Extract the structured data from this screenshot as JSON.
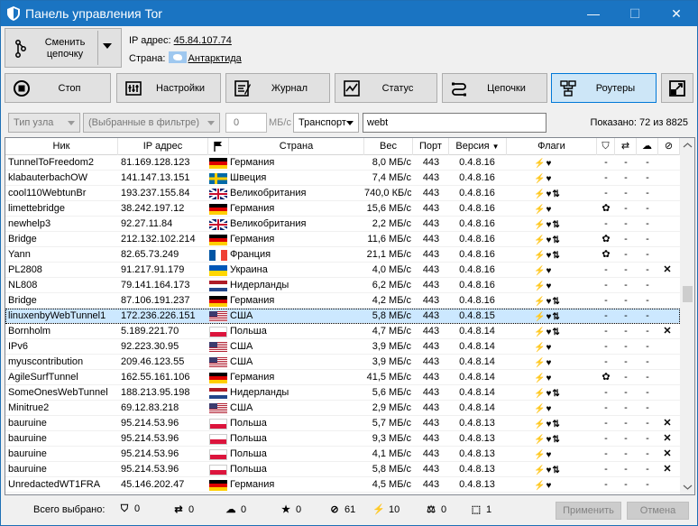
{
  "window": {
    "title": "Панель управления Tor",
    "min": "—",
    "max": "☐",
    "close": "✕"
  },
  "top": {
    "chain_button": "Сменить цепочку",
    "ip_label": "IP адрес:",
    "ip_value": "45.84.107.74",
    "country_label": "Страна:",
    "country_value": "Антарктида"
  },
  "nav": [
    {
      "label": "Стоп",
      "icon": "stop-icon"
    },
    {
      "label": "Настройки",
      "icon": "settings-icon"
    },
    {
      "label": "Журнал",
      "icon": "journal-icon"
    },
    {
      "label": "Статус",
      "icon": "status-icon"
    },
    {
      "label": "Цепочки",
      "icon": "chains-icon"
    },
    {
      "label": "Роутеры",
      "icon": "routers-icon",
      "active": true
    }
  ],
  "filters": {
    "node_type": "Тип узла",
    "selection": "(Выбранные в фильтре)",
    "speed_value": "0",
    "speed_unit": "МБ/с",
    "transport": "Транспорт",
    "search_value": "webt",
    "shown": "Показано: 72 из 8825"
  },
  "columns": {
    "nick": "Ник",
    "ip": "IP адрес",
    "country": "Страна",
    "weight": "Вес",
    "port": "Порт",
    "version": "Версия",
    "flags": "Флаги"
  },
  "flag_colors": {
    "de": [
      "#000000",
      "#dd0000",
      "#ffce00"
    ],
    "se": "#006aa7",
    "gb": "#012169",
    "fr": [
      "#0055a4",
      "#ffffff",
      "#ef4135"
    ],
    "ua": [
      "#0057b7",
      "#ffd700"
    ],
    "nl": [
      "#ae1c28",
      "#ffffff",
      "#21468b"
    ],
    "us": "#b22234",
    "pl": [
      "#ffffff",
      "#dc143c"
    ]
  },
  "rows": [
    {
      "nick": "TunnelToFreedom2",
      "ip": "81.169.128.123",
      "cc": "de",
      "country": "Германия",
      "speed": "8,0 МБ/с",
      "port": "443",
      "version": "0.4.8.16",
      "flags": "fh",
      "g1": "-",
      "g2": "-",
      "g3": "-",
      "g4": ""
    },
    {
      "nick": "klabauterbachOW",
      "ip": "141.147.13.151",
      "cc": "se",
      "country": "Швеция",
      "speed": "7,4 МБ/с",
      "port": "443",
      "version": "0.4.8.16",
      "flags": "fh",
      "g1": "-",
      "g2": "-",
      "g3": "-",
      "g4": ""
    },
    {
      "nick": "cool110WebtunBr",
      "ip": "193.237.155.84",
      "cc": "gb",
      "country": "Великобритания",
      "speed": "740,0 КБ/с",
      "port": "443",
      "version": "0.4.8.16",
      "flags": "fhs",
      "g1": "-",
      "g2": "-",
      "g3": "-",
      "g4": ""
    },
    {
      "nick": "limettebridge",
      "ip": "38.242.197.12",
      "cc": "de",
      "country": "Германия",
      "speed": "15,6 МБ/с",
      "port": "443",
      "version": "0.4.8.16",
      "flags": "fh",
      "g1": "✿",
      "g2": "-",
      "g3": "-",
      "g4": ""
    },
    {
      "nick": "newhelp3",
      "ip": "92.27.11.84",
      "cc": "gb",
      "country": "Великобритания",
      "speed": "2,2 МБ/с",
      "port": "443",
      "version": "0.4.8.16",
      "flags": "fhs",
      "g1": "-",
      "g2": "-",
      "g3": "-",
      "g4": ""
    },
    {
      "nick": "Bridge",
      "ip": "212.132.102.214",
      "cc": "de",
      "country": "Германия",
      "speed": "11,6 МБ/с",
      "port": "443",
      "version": "0.4.8.16",
      "flags": "fhs",
      "g1": "✿",
      "g2": "-",
      "g3": "-",
      "g4": ""
    },
    {
      "nick": "Yann",
      "ip": "82.65.73.249",
      "cc": "fr",
      "country": "Франция",
      "speed": "21,1 МБ/с",
      "port": "443",
      "version": "0.4.8.16",
      "flags": "fhs",
      "g1": "✿",
      "g2": "-",
      "g3": "-",
      "g4": ""
    },
    {
      "nick": "PL2808",
      "ip": "91.217.91.179",
      "cc": "ua",
      "country": "Украина",
      "speed": "4,0 МБ/с",
      "port": "443",
      "version": "0.4.8.16",
      "flags": "fh",
      "g1": "-",
      "g2": "-",
      "g3": "-",
      "g4": "✕"
    },
    {
      "nick": "NL808",
      "ip": "79.141.164.173",
      "cc": "nl",
      "country": "Нидерланды",
      "speed": "6,2 МБ/с",
      "port": "443",
      "version": "0.4.8.16",
      "flags": "fh",
      "g1": "-",
      "g2": "-",
      "g3": "-",
      "g4": ""
    },
    {
      "nick": "Bridge",
      "ip": "87.106.191.237",
      "cc": "de",
      "country": "Германия",
      "speed": "4,2 МБ/с",
      "port": "443",
      "version": "0.4.8.16",
      "flags": "fhs",
      "g1": "-",
      "g2": "-",
      "g3": "-",
      "g4": ""
    },
    {
      "nick": "linuxenbyWebTunnel1",
      "ip": "172.236.226.151",
      "cc": "us",
      "country": "США",
      "speed": "5,8 МБ/с",
      "port": "443",
      "version": "0.4.8.15",
      "flags": "fhs",
      "g1": "-",
      "g2": "-",
      "g3": "-",
      "g4": "",
      "selected": true
    },
    {
      "nick": "Bornholm",
      "ip": "5.189.221.70",
      "cc": "pl",
      "country": "Польша",
      "speed": "4,7 МБ/с",
      "port": "443",
      "version": "0.4.8.14",
      "flags": "fhs",
      "g1": "-",
      "g2": "-",
      "g3": "-",
      "g4": "✕"
    },
    {
      "nick": "IPv6",
      "ip": "92.223.30.95",
      "cc": "us",
      "country": "США",
      "speed": "3,9 МБ/с",
      "port": "443",
      "version": "0.4.8.14",
      "flags": "fh",
      "g1": "-",
      "g2": "-",
      "g3": "-",
      "g4": ""
    },
    {
      "nick": "myuscontribution",
      "ip": "209.46.123.55",
      "cc": "us",
      "country": "США",
      "speed": "3,9 МБ/с",
      "port": "443",
      "version": "0.4.8.14",
      "flags": "fh",
      "g1": "-",
      "g2": "-",
      "g3": "-",
      "g4": ""
    },
    {
      "nick": "AgileSurfTunnel",
      "ip": "162.55.161.106",
      "cc": "de",
      "country": "Германия",
      "speed": "41,5 МБ/с",
      "port": "443",
      "version": "0.4.8.14",
      "flags": "fh",
      "g1": "✿",
      "g2": "-",
      "g3": "-",
      "g4": ""
    },
    {
      "nick": "SomeOnesWebTunnel",
      "ip": "188.213.95.198",
      "cc": "nl",
      "country": "Нидерланды",
      "speed": "5,6 МБ/с",
      "port": "443",
      "version": "0.4.8.14",
      "flags": "fhs",
      "g1": "-",
      "g2": "-",
      "g3": "-",
      "g4": ""
    },
    {
      "nick": "Minitrue2",
      "ip": "69.12.83.218",
      "cc": "us",
      "country": "США",
      "speed": "2,9 МБ/с",
      "port": "443",
      "version": "0.4.8.14",
      "flags": "fh",
      "g1": "-",
      "g2": "-",
      "g3": "-",
      "g4": ""
    },
    {
      "nick": "bauruine",
      "ip": "95.214.53.96",
      "cc": "pl",
      "country": "Польша",
      "speed": "5,7 МБ/с",
      "port": "443",
      "version": "0.4.8.13",
      "flags": "fhs",
      "g1": "-",
      "g2": "-",
      "g3": "-",
      "g4": "✕"
    },
    {
      "nick": "bauruine",
      "ip": "95.214.53.96",
      "cc": "pl",
      "country": "Польша",
      "speed": "9,3 МБ/с",
      "port": "443",
      "version": "0.4.8.13",
      "flags": "fhs",
      "g1": "-",
      "g2": "-",
      "g3": "-",
      "g4": "✕"
    },
    {
      "nick": "bauruine",
      "ip": "95.214.53.96",
      "cc": "pl",
      "country": "Польша",
      "speed": "4,1 МБ/с",
      "port": "443",
      "version": "0.4.8.13",
      "flags": "fh",
      "g1": "-",
      "g2": "-",
      "g3": "-",
      "g4": "✕"
    },
    {
      "nick": "bauruine",
      "ip": "95.214.53.96",
      "cc": "pl",
      "country": "Польша",
      "speed": "5,8 МБ/с",
      "port": "443",
      "version": "0.4.8.13",
      "flags": "fhs",
      "g1": "-",
      "g2": "-",
      "g3": "-",
      "g4": "✕"
    },
    {
      "nick": "UnredactedWT1FRA",
      "ip": "45.146.202.47",
      "cc": "de",
      "country": "Германия",
      "speed": "4,5 МБ/с",
      "port": "443",
      "version": "0.4.8.13",
      "flags": "fh",
      "g1": "-",
      "g2": "-",
      "g3": "-",
      "g4": ""
    }
  ],
  "footer": {
    "label": "Всего выбрано:",
    "counts": [
      {
        "icon": "shield-icon",
        "glyph": "⛉",
        "value": "0"
      },
      {
        "icon": "swap-icon",
        "glyph": "⇄",
        "value": "0"
      },
      {
        "icon": "cloud-icon",
        "glyph": "☁",
        "value": "0"
      },
      {
        "icon": "star-icon",
        "glyph": "★",
        "value": "0"
      },
      {
        "icon": "ban-icon",
        "glyph": "⊘",
        "value": "61"
      },
      {
        "icon": "fast-icon",
        "glyph": "⚡",
        "value": "10"
      },
      {
        "icon": "balance-icon",
        "glyph": "⚖",
        "value": "0"
      },
      {
        "icon": "select-icon",
        "glyph": "⬚",
        "value": "1"
      }
    ],
    "apply": "Применить",
    "cancel": "Отмена"
  }
}
